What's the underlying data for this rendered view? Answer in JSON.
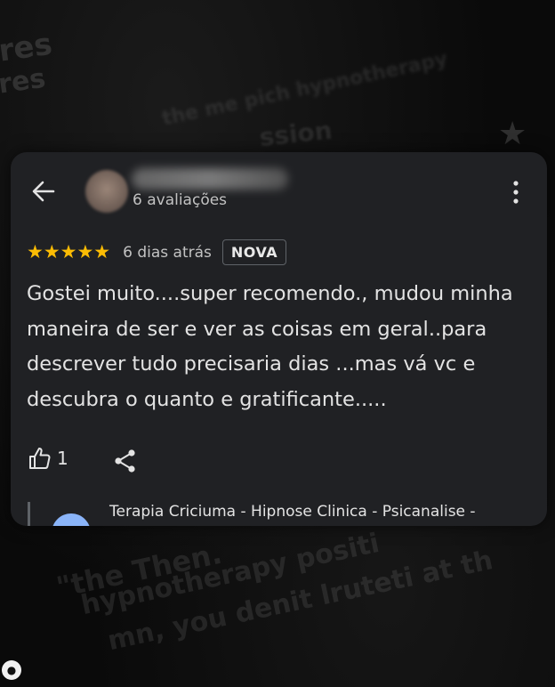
{
  "background": {
    "lines": [
      "res",
      "res",
      "the me pich hypnotherapy",
      "ssion",
      "\"the Then.",
      "hypnotherapy positi",
      "mn, you denit lruteti at th"
    ]
  },
  "review": {
    "reviewer_meta": "6 avaliações",
    "rating": 5,
    "stars": "★★★★★",
    "date": "6 dias atrás",
    "badge": "NOVA",
    "text": "Gostei muito....super recomendo., mudou minha maneira de ser e ver as coisas em geral..para descrever tudo precisaria dias ...mas vá vc e descubra o quanto e gratificante.....",
    "likes": "1"
  },
  "owner_reply": {
    "name": "Terapia Criciuma - Hipnose Clinica - Psicanalise -"
  },
  "icons": {
    "back": "arrow-left-icon",
    "more": "more-vertical-icon",
    "like": "thumbs-up-icon",
    "share": "share-icon"
  },
  "colors": {
    "card_bg": "#202124",
    "star": "#fbbc04",
    "text": "#e3e3e3",
    "secondary_text": "#c2c2c2"
  }
}
